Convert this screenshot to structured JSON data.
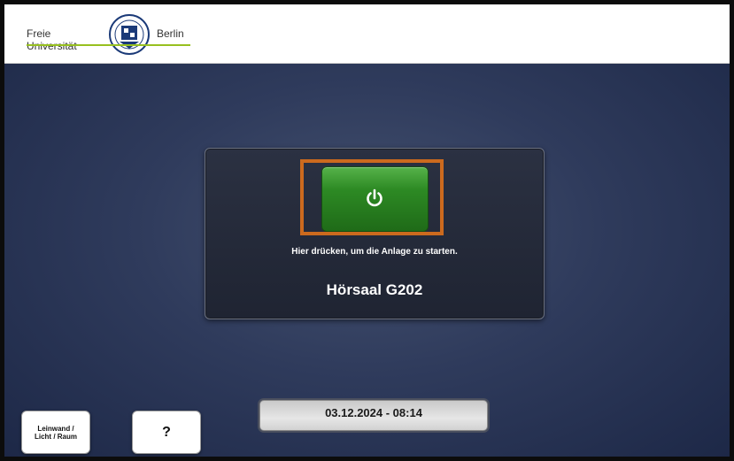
{
  "header": {
    "logo_left": "Freie Universität",
    "logo_right": "Berlin"
  },
  "main": {
    "power_button_icon": "power-icon",
    "hint_text": "Hier drücken, um die Anlage zu starten.",
    "room_name": "Hörsaal G202",
    "datetime": "03.12.2024  -  08:14",
    "screen_button_label_1": "Leinwand /",
    "screen_button_label_2": "Licht / Raum",
    "help_button_label": "?"
  },
  "colors": {
    "accent_green": "#2d8a24",
    "highlight_orange": "#cc6a1e",
    "background_blue": "#2f3b5c"
  }
}
